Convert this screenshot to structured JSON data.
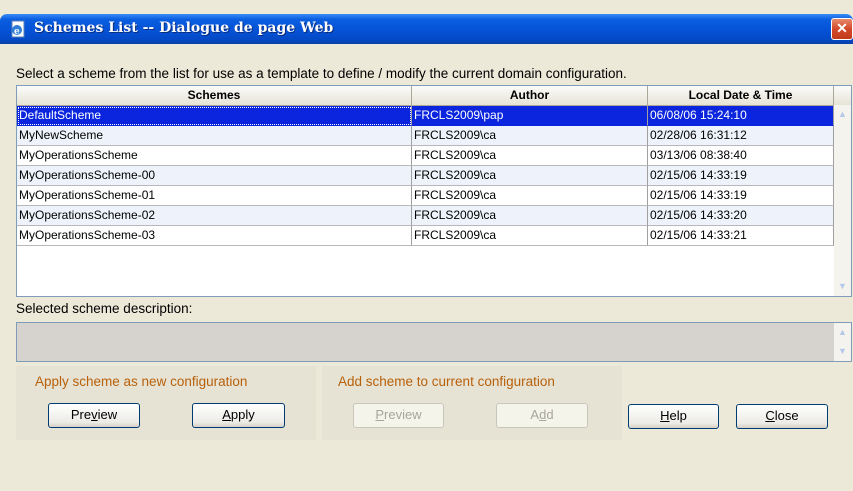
{
  "window": {
    "title": "Schemes List -- Dialogue de page Web",
    "close_glyph": "✕"
  },
  "instructions": "Select a scheme from the list for use as a template to define / modify the current domain configuration.",
  "table": {
    "columns": [
      "Schemes",
      "Author",
      "Local Date & Time"
    ],
    "selected_row": 0,
    "rows": [
      [
        "DefaultScheme",
        "FRCLS2009\\pap",
        "06/08/06 15:24:10"
      ],
      [
        "MyNewScheme",
        "FRCLS2009\\ca",
        "02/28/06 16:31:12"
      ],
      [
        "MyOperationsScheme",
        "FRCLS2009\\ca",
        "03/13/06 08:38:40"
      ],
      [
        "MyOperationsScheme-00",
        "FRCLS2009\\ca",
        "02/15/06 14:33:19"
      ],
      [
        "MyOperationsScheme-01",
        "FRCLS2009\\ca",
        "02/15/06 14:33:19"
      ],
      [
        "MyOperationsScheme-02",
        "FRCLS2009\\ca",
        "02/15/06 14:33:20"
      ],
      [
        "MyOperationsScheme-03",
        "FRCLS2009\\ca",
        "02/15/06 14:33:21"
      ]
    ]
  },
  "description": {
    "label": "Selected scheme description:",
    "value": ""
  },
  "apply_group": {
    "label": "Apply scheme as new configuration",
    "preview_pre": "Pre",
    "preview_key": "v",
    "preview_post": "iew",
    "apply_pre": "",
    "apply_key": "A",
    "apply_post": "pply"
  },
  "add_group": {
    "label": "Add scheme to current configuration",
    "preview_pre": "",
    "preview_key": "P",
    "preview_post": "review",
    "add_pre": "A",
    "add_key": "d",
    "add_post": "d"
  },
  "help": {
    "pre": "",
    "key": "H",
    "post": "elp"
  },
  "close": {
    "pre": "",
    "key": "C",
    "post": "lose"
  }
}
